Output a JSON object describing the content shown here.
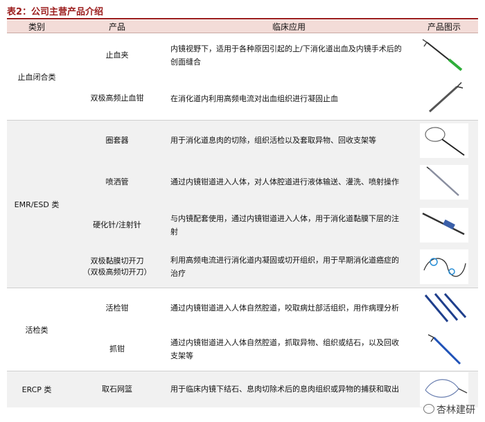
{
  "table_title": "表2：公司主营产品介绍",
  "headers": [
    "类别",
    "产品",
    "临床应用",
    "产品图示"
  ],
  "rows": [
    {
      "category": "止血闭合类",
      "product": "止血夹",
      "use": "内镜视野下，适用于各种原因引起的上/下消化道出血及内镜手术后的创面缝合",
      "image_icon": "hemostatic-clip-image"
    },
    {
      "product": "双极高频止血钳",
      "use": "在消化道内利用高频电流对出血组织进行凝固止血",
      "image_icon": "bipolar-hemostatic-forceps-image"
    },
    {
      "category": "EMR/ESD 类",
      "product": "圈套器",
      "use": "用于消化道息肉的切除，组织活检以及套取异物、回收支架等",
      "image_icon": "snare-image"
    },
    {
      "product": "喷洒管",
      "use": "通过内镜钳道进入人体，对人体腔道进行液体输送、灌洗、喷射操作",
      "image_icon": "spray-catheter-image"
    },
    {
      "product": "硬化针/注射针",
      "use": "与内镜配套使用，通过内镜钳道进入人体，用于消化道黏膜下层的注射",
      "image_icon": "injection-needle-image"
    },
    {
      "product": "双极黏膜切开刀",
      "product_sub": "（双极高频切开刀）",
      "use": "利用高频电流进行消化道内凝固或切开组织，用于早期消化道癌症的治疗",
      "image_icon": "bipolar-knife-image"
    },
    {
      "category": "活检类",
      "product": "活检钳",
      "use": "通过内镜钳道进入人体自然腔道，咬取病灶部活组织，用作病理分析",
      "image_icon": "biopsy-forceps-image"
    },
    {
      "product": "抓钳",
      "use": "通过内镜钳道进入人体自然腔道，抓取异物、组织或结石，以及回收支架等",
      "image_icon": "grasping-forceps-image"
    },
    {
      "category": "ERCP 类",
      "product": "取石网篮",
      "use": "用于临床内镜下结石、息肉切除术后的息肉组织或异物的捕获和取出",
      "image_icon": "stone-basket-image"
    }
  ],
  "watermark": "杏林建研"
}
